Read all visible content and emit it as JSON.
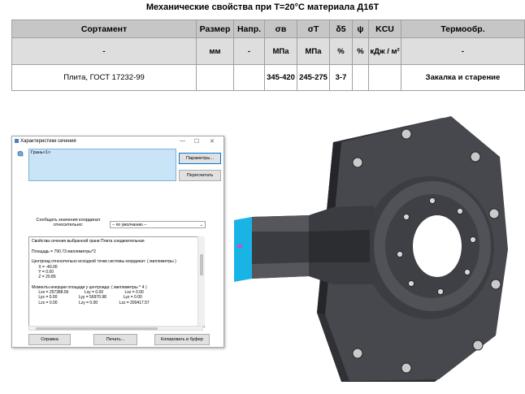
{
  "table": {
    "title": "Механические свойства при Т=20°С материала Д16Т",
    "headers": {
      "sortament": "Сортамент",
      "razmer": "Размер",
      "napr": "Напр.",
      "sigma_v": "σв",
      "sigma_t": "σT",
      "delta5": "δ5",
      "psi": "ψ",
      "kcu": "KCU",
      "termo": "Термообр."
    },
    "units": {
      "sortament": "-",
      "razmer": "мм",
      "napr": "-",
      "sigma_v": "МПа",
      "sigma_t": "МПа",
      "delta5": "%",
      "psi": "%",
      "kcu": "кДж / м²",
      "termo": "-"
    },
    "row": {
      "sortament": "Плита, ГОСТ 17232-99",
      "razmer": "",
      "napr": "",
      "sigma_v": "345-420",
      "sigma_t": "245-275",
      "delta5": "3-7",
      "psi": "",
      "kcu": "",
      "termo": "Закалка и старение"
    }
  },
  "dialog": {
    "title": "Характеристики сечения",
    "face_item": "Грань<1>",
    "params_button": "Параметры...",
    "recalc_button": "Пересчитать",
    "coords_label": "Сообщать значения координат относительно:",
    "coords_value": "-- по умолчанию --",
    "results": [
      "Свойства сечения выбранной грани Плита соединительная",
      "",
      "Площадь = 790.73 миллиметры^2",
      "",
      "Центроид относительно исходной точки системы координат: ( миллиметры )",
      "      X = -40.00",
      "      Y = 0.00",
      "      Z = 20.85",
      "",
      "Моменты инерции площади у центроида: ( миллиметры ^ 4 )",
      "      Lxx = 257388.56              Lxy = 0.00                   Lxz = 0.00",
      "      Lyx = 0.00                   Lyy = 56970.98               Lyz = 0.00",
      "      Lzx = 0.00                   Lzy = 0.00                   Lzz = 200417.57"
    ],
    "help_button": "Справка",
    "print_button": "Печать...",
    "copy_button": "Копировать в буфер"
  },
  "colors": {
    "header_bg": "#c6c6c6",
    "units_bg": "#dedede",
    "face_highlight": "#18b4e6",
    "model_body": "#3d3f44"
  }
}
